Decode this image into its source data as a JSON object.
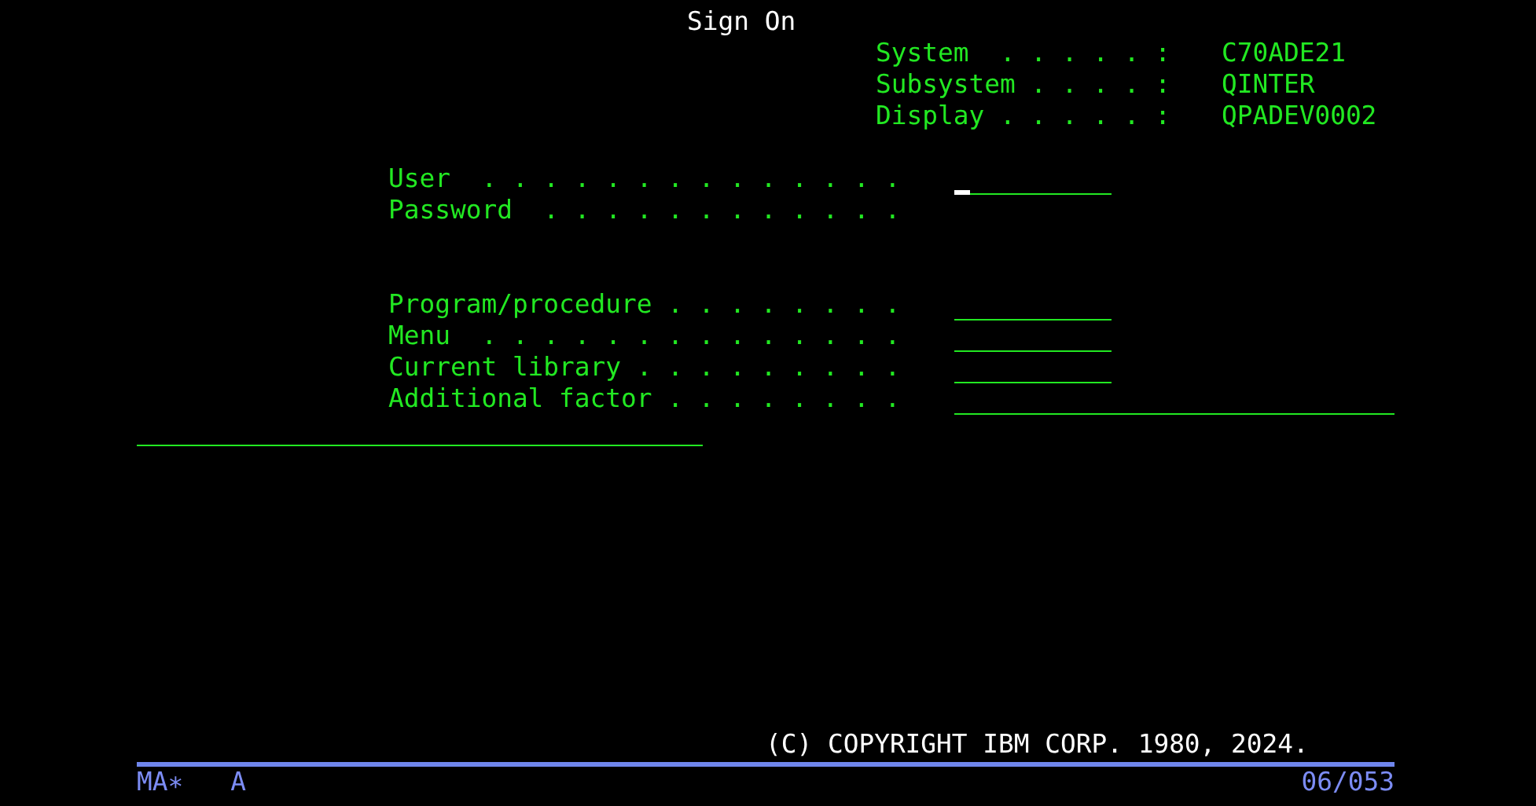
{
  "title": "Sign On",
  "system_info": [
    {
      "label": "System  . . . . . :",
      "value": "C70ADE21"
    },
    {
      "label": "Subsystem . . . . :",
      "value": "QINTER"
    },
    {
      "label": "Display . . . . . :",
      "value": "QPADEV0002"
    }
  ],
  "fields": [
    {
      "label": "User  . . . . . . . . . . . . . .",
      "kind": "input",
      "cursor": true
    },
    {
      "label": "Password  . . . . . . . . . . . .",
      "kind": "hidden"
    },
    {
      "label": "Program/procedure . . . . . . . .",
      "kind": "input",
      "cursor": false
    },
    {
      "label": "Menu  . . . . . . . . . . . . . .",
      "kind": "input",
      "cursor": false
    },
    {
      "label": "Current library . . . . . . . . .",
      "kind": "input",
      "cursor": false
    },
    {
      "label": "Additional factor . . . . . . . .",
      "kind": "long_input",
      "cursor": false
    }
  ],
  "message_field": {
    "kind": "input"
  },
  "copyright": "(C) COPYRIGHT IBM CORP. 1980, 2024.",
  "status_bar": {
    "mode": "MA∗",
    "indicator": "A",
    "position": "06/053"
  }
}
